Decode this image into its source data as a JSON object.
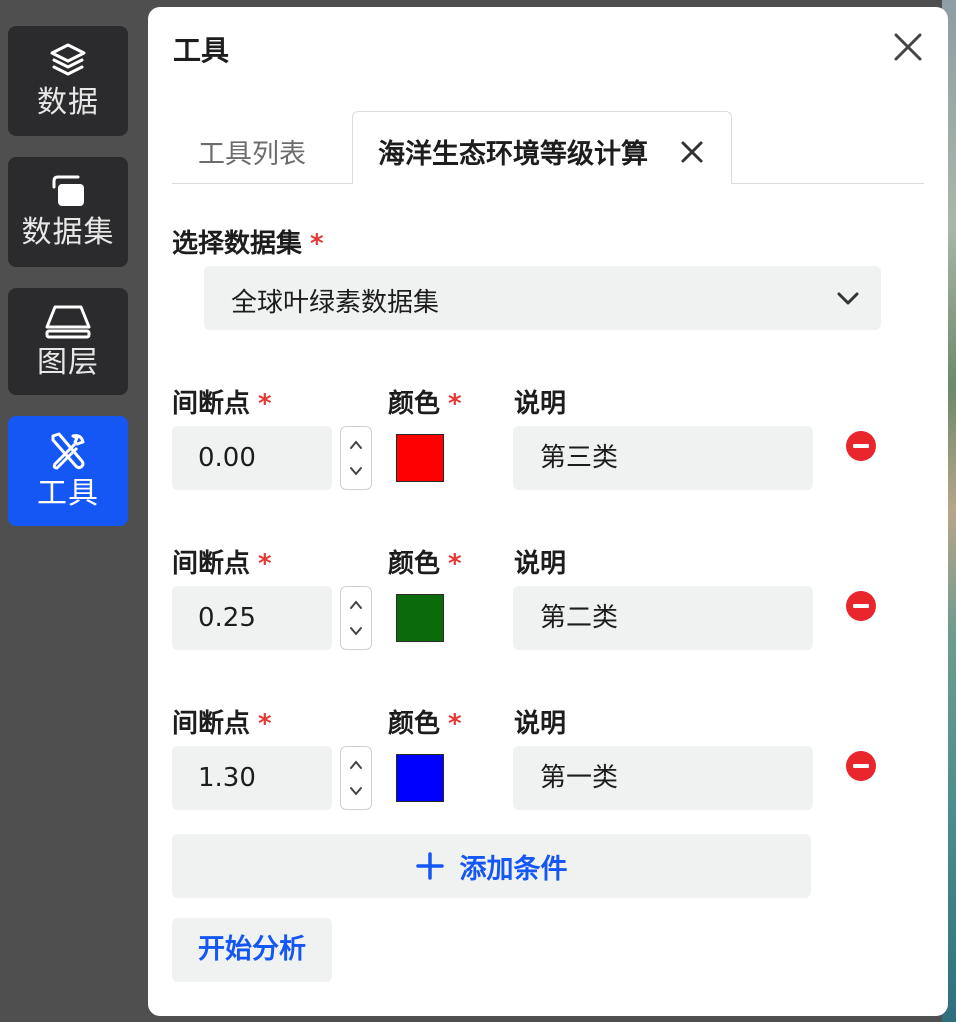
{
  "sidebar": {
    "items": [
      {
        "label": "数据",
        "icon": "layers-icon",
        "active": false
      },
      {
        "label": "数据集",
        "icon": "dataset-icon",
        "active": false
      },
      {
        "label": "图层",
        "icon": "layer-icon",
        "active": false
      },
      {
        "label": "工具",
        "icon": "tools-icon",
        "active": true
      }
    ]
  },
  "panel": {
    "title": "工具",
    "tabs": [
      {
        "label": "工具列表",
        "active": false
      },
      {
        "label": "海洋生态环境等级计算",
        "active": true
      }
    ],
    "dataset_label": "选择数据集",
    "dataset_value": "全球叶绿素数据集",
    "required_mark": "*",
    "column_labels": {
      "breakpoint": "间断点",
      "color": "颜色",
      "description": "说明"
    },
    "conditions": [
      {
        "breakpoint": "0.00",
        "color": "#ff0000",
        "description": "第三类"
      },
      {
        "breakpoint": "0.25",
        "color": "#0b6b0b",
        "description": "第二类"
      },
      {
        "breakpoint": "1.30",
        "color": "#0000ff",
        "description": "第一类"
      }
    ],
    "add_condition_label": "添加条件",
    "start_analysis_label": "开始分析"
  },
  "colors": {
    "accent": "#1557f5",
    "danger": "#e8262b",
    "sidebar_bg": "#2b2b2e"
  }
}
